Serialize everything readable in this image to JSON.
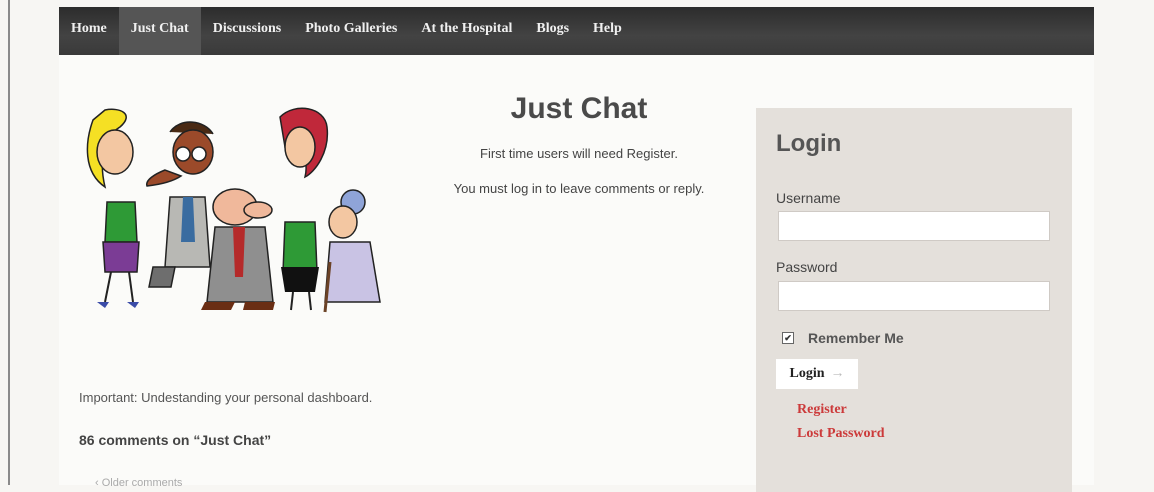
{
  "nav": {
    "items": [
      "Home",
      "Just Chat",
      "Discussions",
      "Photo Galleries",
      "At the Hospital",
      "Blogs",
      "Help"
    ],
    "active_index": 1
  },
  "main": {
    "title": "Just Chat",
    "line1": "First time users will need Register.",
    "line2": "You must log in to leave comments or reply.",
    "dashboard_link": "Important: Undestanding your personal dashboard.",
    "comments_heading": "86 comments on “Just Chat”",
    "older_comments": "‹ Older comments"
  },
  "login": {
    "title": "Login",
    "username_label": "Username",
    "username_value": "",
    "password_label": "Password",
    "password_value": "",
    "remember_label": "Remember Me",
    "remember_checked": true,
    "button_label": "Login",
    "register_link": "Register",
    "lost_password_link": "Lost Password"
  },
  "colors": {
    "nav_bg": "#3a3a3a",
    "nav_active": "#555555",
    "panel_bg": "#e4e0db",
    "link_red": "#cc3a3a"
  }
}
